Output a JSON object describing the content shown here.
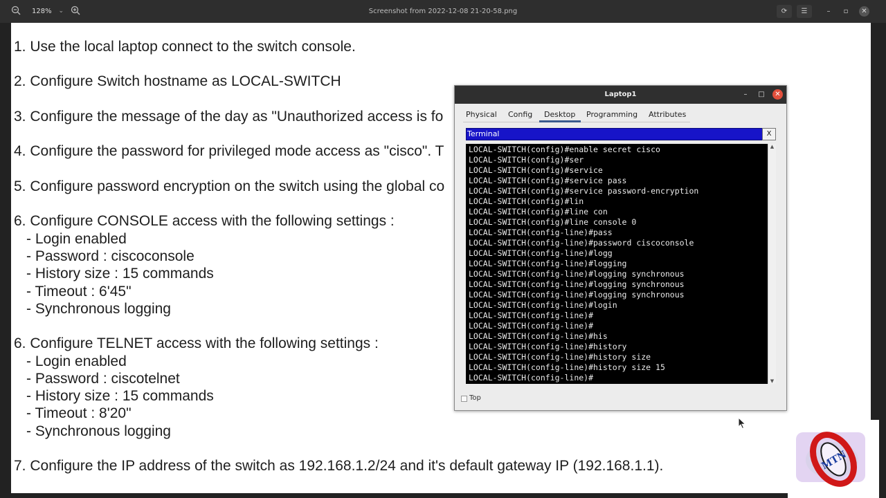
{
  "viewer": {
    "title": "Screenshot from 2022-12-08 21-20-58.png",
    "zoom": "128%"
  },
  "doc_lines": [
    "1. Use the local laptop connect to the switch console.",
    "2. Configure Switch hostname as LOCAL-SWITCH",
    "3. Configure the message of the day as \"Unauthorized access is fo",
    "4. Configure the password for privileged mode access as \"cisco\". T",
    "5. Configure password encryption on the switch using the global co",
    "6. Configure CONSOLE access with the following settings :",
    "- Login enabled",
    "- Password : ciscoconsole",
    "- History size : 15 commands",
    "- Timeout : 6'45\"",
    "- Synchronous logging",
    "6. Configure TELNET access with the following settings :",
    "- Login enabled",
    "- Password : ciscotelnet",
    "- History size : 15 commands",
    "- Timeout : 8'20\"",
    "- Synchronous logging",
    "7. Configure the IP address of the switch as 192.168.1.2/24 and it's default gateway IP (192.168.1.1)."
  ],
  "pt_window": {
    "title": "Laptop1",
    "tabs": [
      "Physical",
      "Config",
      "Desktop",
      "Programming",
      "Attributes"
    ],
    "active_tab": "Desktop",
    "app_title": "Terminal",
    "app_close": "X",
    "top_label": "Top"
  },
  "terminal_lines": [
    "LOCAL-SWITCH(config)#enable secret cisco",
    "LOCAL-SWITCH(config)#ser",
    "LOCAL-SWITCH(config)#service",
    "LOCAL-SWITCH(config)#service pass",
    "LOCAL-SWITCH(config)#service password-encryption",
    "LOCAL-SWITCH(config)#lin",
    "LOCAL-SWITCH(config)#line con",
    "LOCAL-SWITCH(config)#line console 0",
    "LOCAL-SWITCH(config-line)#pass",
    "LOCAL-SWITCH(config-line)#password ciscoconsole",
    "LOCAL-SWITCH(config-line)#logg",
    "LOCAL-SWITCH(config-line)#logging",
    "LOCAL-SWITCH(config-line)#logging synchronous",
    "LOCAL-SWITCH(config-line)#logging synchronous",
    "LOCAL-SWITCH(config-line)#logging synchronous",
    "LOCAL-SWITCH(config-line)#login",
    "LOCAL-SWITCH(config-line)#",
    "LOCAL-SWITCH(config-line)#",
    "LOCAL-SWITCH(config-line)#his",
    "LOCAL-SWITCH(config-line)#history",
    "LOCAL-SWITCH(config-line)#history size",
    "LOCAL-SWITCH(config-line)#history size 15",
    "LOCAL-SWITCH(config-line)#"
  ],
  "logo": {
    "text": "MTN"
  },
  "icons": {
    "zoom_out": "zoom-out-icon",
    "zoom_in": "zoom-in-icon",
    "cursor": "mouse-pointer-icon"
  }
}
